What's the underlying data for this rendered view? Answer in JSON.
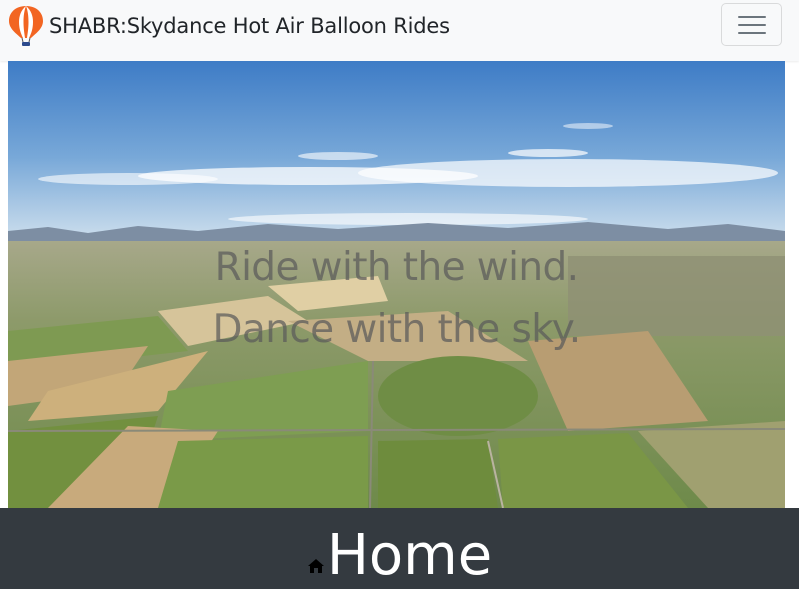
{
  "navbar": {
    "brand_text": "SHABR:Skydance Hot Air Balloon Rides",
    "logo_icon": "hot-air-balloon-icon",
    "toggler_icon": "hamburger-menu-icon"
  },
  "hero": {
    "caption_line1": "Ride with the wind.",
    "caption_line2": "Dance with the sky."
  },
  "home": {
    "heading": "Home",
    "icon": "house-icon"
  },
  "colors": {
    "navbar_bg": "#f8f9fa",
    "footer_bg": "#343a40",
    "balloon_orange": "#f26522"
  }
}
